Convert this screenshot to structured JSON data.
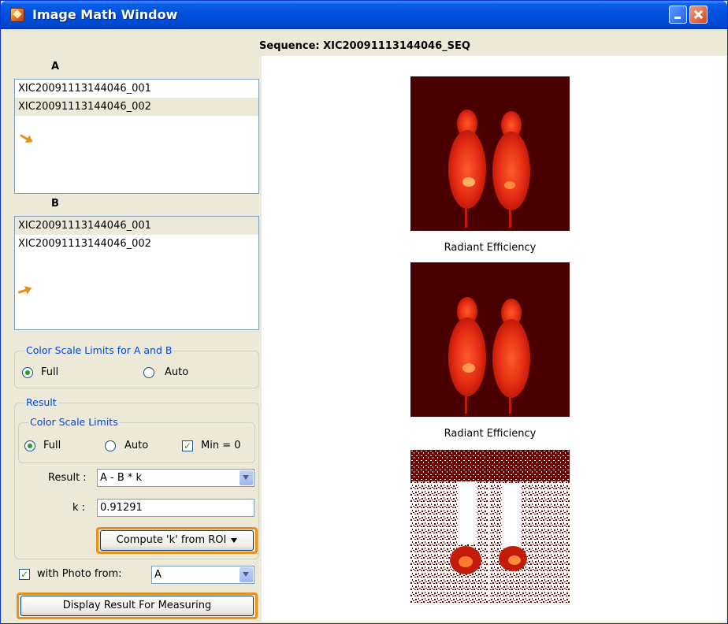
{
  "window": {
    "title": "Image Math Window"
  },
  "sequence_label": "Sequence: XIC20091113144046_SEQ",
  "list_a": {
    "label": "A",
    "items": [
      "XIC20091113144046_001",
      "XIC20091113144046_002"
    ],
    "selected_index": 1
  },
  "list_b": {
    "label": "B",
    "items": [
      "XIC20091113144046_001",
      "XIC20091113144046_002"
    ],
    "selected_index": 0
  },
  "color_scale_ab": {
    "legend": "Color Scale Limits for A and B",
    "full_label": "Full",
    "auto_label": "Auto",
    "selected": "Full"
  },
  "result_group": {
    "legend": "Result",
    "color_scale": {
      "legend": "Color Scale Limits",
      "full_label": "Full",
      "auto_label": "Auto",
      "min0_label": "Min = 0",
      "selected": "Full",
      "min0_checked": true
    },
    "result_label": "Result :",
    "result_value": "A - B * k",
    "k_label": "k :",
    "k_value": "0.91291",
    "compute_button": "Compute 'k' from ROI"
  },
  "photo": {
    "label": "with Photo from:",
    "value": "A",
    "checked": true
  },
  "display_button": "Display Result For Measuring",
  "images": {
    "caption_a": "Radiant Efficiency",
    "caption_b": "Radiant Efficiency"
  },
  "colors": {
    "highlight": "#e6911c",
    "title_bar": "#0052e0",
    "image_bg": "#4a0000"
  }
}
